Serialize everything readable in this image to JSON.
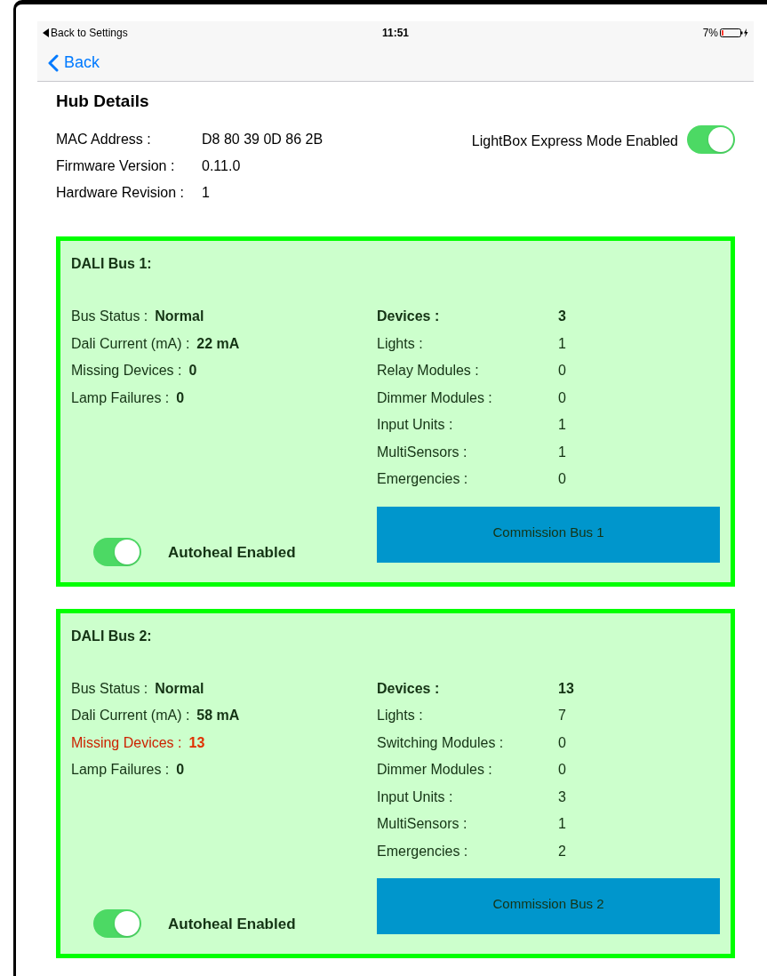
{
  "status_bar": {
    "back_app": "Back to Settings",
    "time": "11:51",
    "battery": "7%"
  },
  "nav": {
    "back": "Back"
  },
  "hub": {
    "title": "Hub Details",
    "fields": [
      {
        "label": "MAC Address :",
        "value": "D8 80 39 0D 86 2B"
      },
      {
        "label": "Firmware Version :",
        "value": "0.11.0"
      },
      {
        "label": "Hardware Revision :",
        "value": "1"
      }
    ],
    "express_mode": {
      "label": "LightBox Express Mode Enabled",
      "on": true
    }
  },
  "buses": [
    {
      "title": "DALI Bus 1:",
      "stats": [
        {
          "label": "Bus Status :",
          "value": "Normal",
          "alert": false
        },
        {
          "label": "Dali Current (mA) :",
          "value": "22 mA",
          "alert": false
        },
        {
          "label": "Missing Devices :",
          "value": "0",
          "alert": false
        },
        {
          "label": "Lamp Failures :",
          "value": "0",
          "alert": false
        }
      ],
      "counts": [
        {
          "kind": "total",
          "label": "Devices :",
          "value": "3"
        },
        {
          "kind": "count",
          "label": "Lights :",
          "value": "1"
        },
        {
          "kind": "count",
          "label": "Relay Modules :",
          "value": "0"
        },
        {
          "kind": "count",
          "label": "Dimmer Modules :",
          "value": "0"
        },
        {
          "kind": "count",
          "label": "Input Units :",
          "value": "1"
        },
        {
          "kind": "count",
          "label": "MultiSensors :",
          "value": "1"
        },
        {
          "kind": "count",
          "label": "Emergencies :",
          "value": "0"
        }
      ],
      "autoheal": {
        "label": "Autoheal Enabled",
        "on": true
      },
      "button": "Commission Bus 1"
    },
    {
      "title": "DALI Bus 2:",
      "stats": [
        {
          "label": "Bus Status :",
          "value": "Normal",
          "alert": false
        },
        {
          "label": "Dali Current (mA) :",
          "value": "58 mA",
          "alert": false
        },
        {
          "label": "Missing Devices :",
          "value": "13",
          "alert": true
        },
        {
          "label": "Lamp Failures :",
          "value": "0",
          "alert": false
        }
      ],
      "counts": [
        {
          "kind": "total",
          "label": "Devices :",
          "value": "13"
        },
        {
          "kind": "count",
          "label": "Lights :",
          "value": "7"
        },
        {
          "kind": "count",
          "label": "Switching Modules :",
          "value": "0"
        },
        {
          "kind": "count",
          "label": "Dimmer Modules :",
          "value": "0"
        },
        {
          "kind": "count",
          "label": "Input Units :",
          "value": "3"
        },
        {
          "kind": "count",
          "label": "MultiSensors :",
          "value": "1"
        },
        {
          "kind": "count",
          "label": "Emergencies :",
          "value": "2"
        }
      ],
      "autoheal": {
        "label": "Autoheal Enabled",
        "on": true
      },
      "button": "Commission Bus 2"
    }
  ]
}
